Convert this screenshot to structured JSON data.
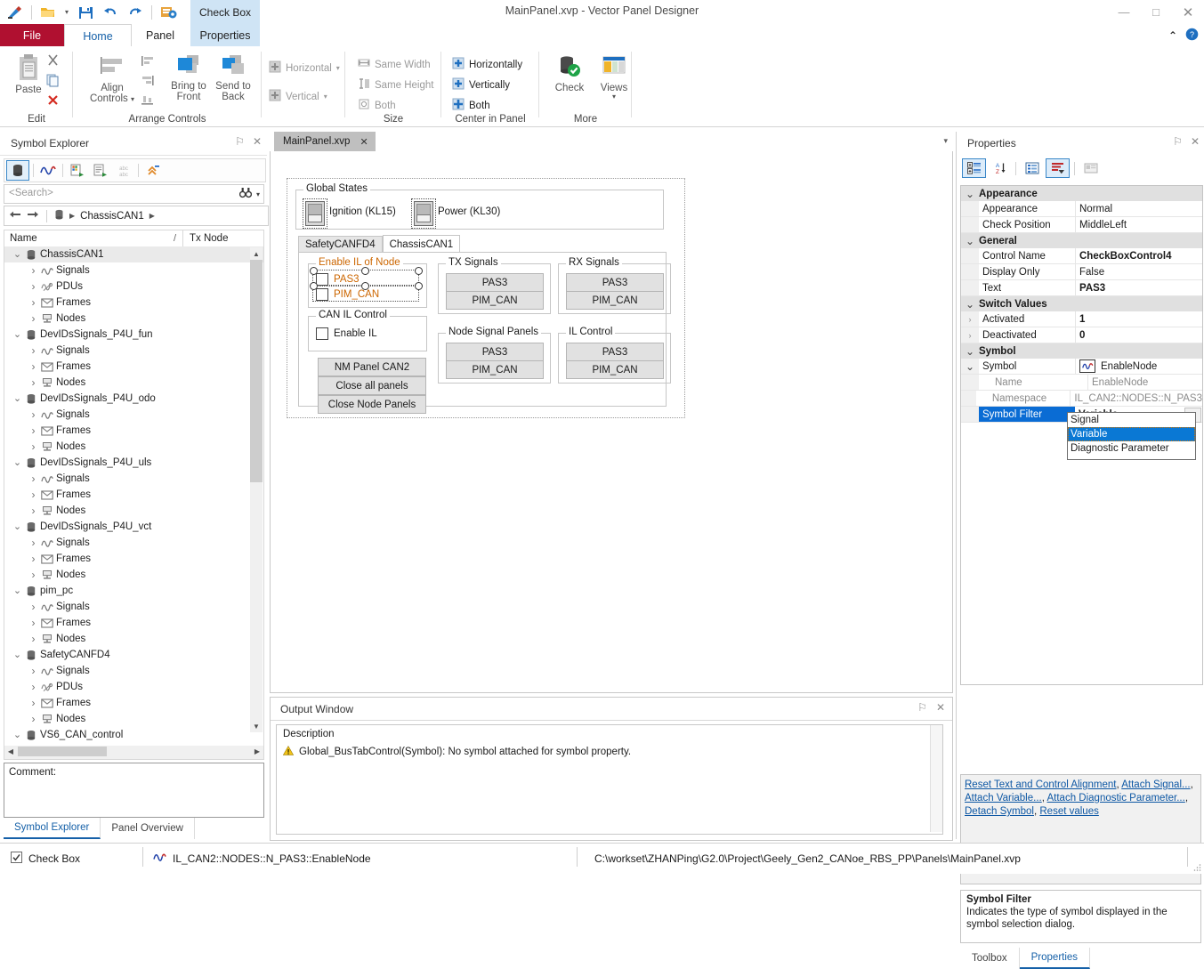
{
  "window": {
    "title": "MainPanel.xvp - Vector Panel Designer",
    "minimize": "—",
    "maximize": "□",
    "close": "✕",
    "ribbon_collapse": "⌃",
    "help": "?"
  },
  "quick_access": [
    {
      "name": "app-logo-icon",
      "glyph": "✎"
    },
    {
      "name": "open-icon",
      "glyph": "▰"
    },
    {
      "name": "qat-dropdown-icon",
      "glyph": "▾"
    },
    {
      "name": "save-icon",
      "glyph": "■"
    },
    {
      "name": "undo-icon",
      "glyph": "↶"
    },
    {
      "name": "redo-icon",
      "glyph": "↷"
    },
    {
      "name": "panel-config-icon",
      "glyph": "▣"
    }
  ],
  "ribbon": {
    "context_tab": "Check Box",
    "tabs": [
      {
        "id": "file",
        "label": "File"
      },
      {
        "id": "home",
        "label": "Home"
      },
      {
        "id": "panel",
        "label": "Panel"
      },
      {
        "id": "props",
        "label": "Properties"
      }
    ],
    "groups": {
      "edit": {
        "label": "Edit",
        "paste": "Paste",
        "cut": "✂",
        "copy": "❐",
        "delete": "✕"
      },
      "arrange": {
        "label": "Arrange Controls",
        "align": "Align",
        "align2": "Controls",
        "bring_to_front": "Bring to",
        "bring_to_front2": "Front",
        "send_to_back": "Send to",
        "send_to_back2": "Back",
        "horizontal": "Horizontal",
        "vertical": "Vertical"
      },
      "size": {
        "label": "Size",
        "same_width": "Same Width",
        "same_height": "Same Height",
        "both": "Both"
      },
      "center": {
        "label": "Center in Panel",
        "horizontally": "Horizontally",
        "vertically": "Vertically",
        "both": "Both"
      },
      "more": {
        "label": "More",
        "check": "Check",
        "views": "Views"
      }
    }
  },
  "symbol_explorer": {
    "title": "Symbol Explorer",
    "pin": "⚐",
    "close": "✕",
    "search_placeholder": "<Search>",
    "breadcrumb": "ChassisCAN1",
    "columns": {
      "name": "Name",
      "sort": "/",
      "tx_node": "Tx Node"
    },
    "comment_label": "Comment:",
    "tree": [
      {
        "label": "ChassisCAN1",
        "level": 0,
        "icon": "database-icon",
        "expanded": true,
        "selected": true
      },
      {
        "label": "Signals",
        "level": 1,
        "icon": "signal-icon",
        "expanded": false
      },
      {
        "label": "PDUs",
        "level": 1,
        "icon": "pdu-icon",
        "expanded": false
      },
      {
        "label": "Frames",
        "level": 1,
        "icon": "frame-icon",
        "expanded": false
      },
      {
        "label": "Nodes",
        "level": 1,
        "icon": "node-icon",
        "expanded": false
      },
      {
        "label": "DevIDsSignals_P4U_fun",
        "level": 0,
        "icon": "database-icon",
        "expanded": true
      },
      {
        "label": "Signals",
        "level": 1,
        "icon": "signal-icon",
        "expanded": false
      },
      {
        "label": "Frames",
        "level": 1,
        "icon": "frame-icon",
        "expanded": false
      },
      {
        "label": "Nodes",
        "level": 1,
        "icon": "node-icon",
        "expanded": false
      },
      {
        "label": "DevIDsSignals_P4U_odo",
        "level": 0,
        "icon": "database-icon",
        "expanded": true
      },
      {
        "label": "Signals",
        "level": 1,
        "icon": "signal-icon",
        "expanded": false
      },
      {
        "label": "Frames",
        "level": 1,
        "icon": "frame-icon",
        "expanded": false
      },
      {
        "label": "Nodes",
        "level": 1,
        "icon": "node-icon",
        "expanded": false
      },
      {
        "label": "DevIDsSignals_P4U_uls",
        "level": 0,
        "icon": "database-icon",
        "expanded": true
      },
      {
        "label": "Signals",
        "level": 1,
        "icon": "signal-icon",
        "expanded": false
      },
      {
        "label": "Frames",
        "level": 1,
        "icon": "frame-icon",
        "expanded": false
      },
      {
        "label": "Nodes",
        "level": 1,
        "icon": "node-icon",
        "expanded": false
      },
      {
        "label": "DevIDsSignals_P4U_vct",
        "level": 0,
        "icon": "database-icon",
        "expanded": true
      },
      {
        "label": "Signals",
        "level": 1,
        "icon": "signal-icon",
        "expanded": false
      },
      {
        "label": "Frames",
        "level": 1,
        "icon": "frame-icon",
        "expanded": false
      },
      {
        "label": "Nodes",
        "level": 1,
        "icon": "node-icon",
        "expanded": false
      },
      {
        "label": "pim_pc",
        "level": 0,
        "icon": "database-icon",
        "expanded": true
      },
      {
        "label": "Signals",
        "level": 1,
        "icon": "signal-icon",
        "expanded": false
      },
      {
        "label": "Frames",
        "level": 1,
        "icon": "frame-icon",
        "expanded": false
      },
      {
        "label": "Nodes",
        "level": 1,
        "icon": "node-icon",
        "expanded": false
      },
      {
        "label": "SafetyCANFD4",
        "level": 0,
        "icon": "database-icon",
        "expanded": true
      },
      {
        "label": "Signals",
        "level": 1,
        "icon": "signal-icon",
        "expanded": false
      },
      {
        "label": "PDUs",
        "level": 1,
        "icon": "pdu-icon",
        "expanded": false
      },
      {
        "label": "Frames",
        "level": 1,
        "icon": "frame-icon",
        "expanded": false
      },
      {
        "label": "Nodes",
        "level": 1,
        "icon": "node-icon",
        "expanded": false
      },
      {
        "label": "VS6_CAN_control",
        "level": 0,
        "icon": "database-icon",
        "expanded": true
      }
    ],
    "dock_tabs": [
      {
        "label": "Symbol Explorer",
        "active": true
      },
      {
        "label": "Panel Overview",
        "active": false
      }
    ]
  },
  "document": {
    "tab_label": "MainPanel.xvp",
    "tab_close": "✕",
    "tab_caret": "▾"
  },
  "panel": {
    "global_states": {
      "title": "Global States",
      "switches": [
        {
          "label": "Ignition (KL15)"
        },
        {
          "label": "Power (KL30)"
        }
      ]
    },
    "bus_tabs": [
      {
        "label": "SafetyCANFD4",
        "active": false
      },
      {
        "label": "ChassisCAN1",
        "active": true
      }
    ],
    "enable_il_of_node": {
      "title": "Enable IL of Node",
      "items": [
        {
          "label": "PAS3",
          "checked": false
        },
        {
          "label": "PIM_CAN",
          "checked": false
        }
      ]
    },
    "can_il_control": {
      "title": "CAN IL Control",
      "items": [
        {
          "label": "Enable IL",
          "checked": false
        }
      ]
    },
    "left_buttons": [
      "NM Panel CAN2",
      "Close all panels",
      "Close Node Panels"
    ],
    "tx_signals": {
      "title": "TX Signals",
      "buttons": [
        "PAS3",
        "PIM_CAN"
      ]
    },
    "rx_signals": {
      "title": "RX Signals",
      "buttons": [
        "PAS3",
        "PIM_CAN"
      ]
    },
    "node_signal_panels": {
      "title": "Node Signal Panels",
      "buttons": [
        "PAS3",
        "PIM_CAN"
      ]
    },
    "il_control": {
      "title": "IL Control",
      "buttons": [
        "PAS3",
        "PIM_CAN"
      ]
    }
  },
  "output_window": {
    "title": "Output Window",
    "pin": "⚐",
    "close": "✕",
    "description_header": "Description",
    "messages": [
      {
        "severity": "warning",
        "icon": "warning-icon",
        "text": "Global_BusTabControl(Symbol): No symbol attached for symbol property."
      }
    ]
  },
  "properties": {
    "title": "Properties",
    "pin": "⚐",
    "close": "✕",
    "toolbar": [
      {
        "name": "categorized-button",
        "active": true
      },
      {
        "name": "alphabetical-sort-button",
        "active": false
      },
      {
        "name": "property-pages-button",
        "active": false
      },
      {
        "name": "property-events-button",
        "active": true
      },
      {
        "name": "description-pane-button",
        "active": false
      }
    ],
    "categories": [
      {
        "name": "Appearance",
        "expanded": true,
        "rows": [
          {
            "name": "Appearance",
            "value": "Normal",
            "bold": false,
            "expander": ""
          },
          {
            "name": "Check Position",
            "value": "MiddleLeft",
            "bold": false,
            "expander": ""
          }
        ]
      },
      {
        "name": "General",
        "expanded": true,
        "rows": [
          {
            "name": "Control Name",
            "value": "CheckBoxControl4",
            "bold": true,
            "expander": ""
          },
          {
            "name": "Display Only",
            "value": "False",
            "bold": false,
            "expander": ""
          },
          {
            "name": "Text",
            "value": "PAS3",
            "bold": true,
            "expander": ""
          }
        ]
      },
      {
        "name": "Switch Values",
        "expanded": true,
        "rows": [
          {
            "name": "Activated",
            "value": "1",
            "bold": true,
            "expander": "›"
          },
          {
            "name": "Deactivated",
            "value": "0",
            "bold": true,
            "expander": "›"
          }
        ]
      },
      {
        "name": "Symbol",
        "expanded": true,
        "rows": [
          {
            "name": "Symbol",
            "value": "EnableNode",
            "bold": false,
            "expander": "⌄",
            "icon": "signal-icon"
          },
          {
            "name": "Name",
            "value": "EnableNode",
            "bold": false,
            "expander": "",
            "sub": true
          },
          {
            "name": "Namespace",
            "value": "IL_CAN2::NODES::N_PAS3",
            "bold": false,
            "expander": "",
            "sub": true
          },
          {
            "name": "Symbol Filter",
            "value": "Variable",
            "bold": true,
            "expander": "",
            "selected": true,
            "combo": true
          }
        ]
      }
    ],
    "dropdown": {
      "open": true,
      "options": [
        {
          "label": "Signal",
          "selected": false
        },
        {
          "label": "Variable",
          "selected": true
        },
        {
          "label": "Diagnostic Parameter",
          "selected": false
        }
      ]
    },
    "verbs": [
      "Reset Text and Control Alignment",
      "Attach Signal...",
      "Attach Variable...",
      "Attach Diagnostic Parameter...",
      "Detach Symbol",
      "Reset values"
    ],
    "help": {
      "title": "Symbol Filter",
      "description": "Indicates the type of symbol displayed in the symbol selection dialog."
    },
    "dock_tabs": [
      {
        "label": "Toolbox",
        "active": false
      },
      {
        "label": "Properties",
        "active": true
      }
    ]
  },
  "status_bar": {
    "control_type": "Check Box",
    "control_type_icon": "checkbox-icon",
    "symbol_icon": "signal-icon",
    "symbol_path": "IL_CAN2::NODES::N_PAS3::EnableNode",
    "file_path": "C:\\workset\\ZHANPing\\G2.0\\Project\\Geely_Gen2_CANoe_RBS_PP\\Panels\\MainPanel.xvp"
  }
}
